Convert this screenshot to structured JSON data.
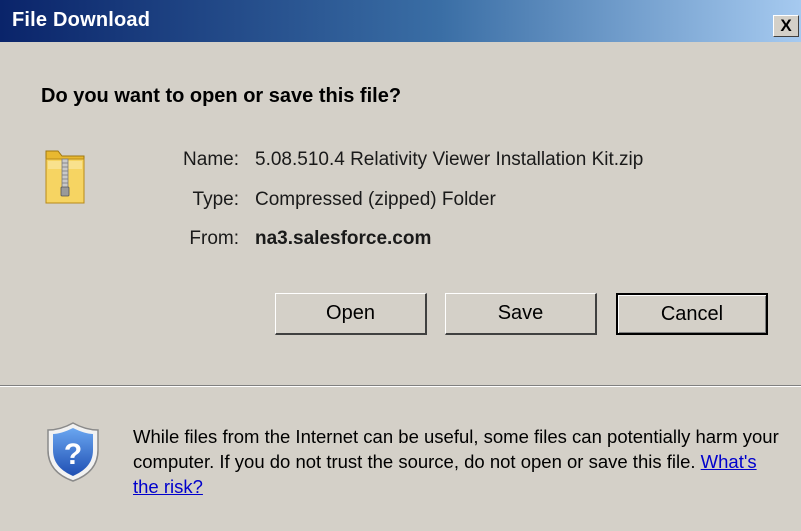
{
  "window": {
    "title": "File Download",
    "close_label": "X"
  },
  "prompt": {
    "question": "Do you want to open or save this file?"
  },
  "file": {
    "icon": "zip-folder-icon",
    "name_label": "Name:",
    "name_value": "5.08.510.4 Relativity Viewer Installation Kit.zip",
    "type_label": "Type:",
    "type_value": "Compressed (zipped) Folder",
    "from_label": "From:",
    "from_value": "na3.salesforce.com"
  },
  "buttons": {
    "open": "Open",
    "save": "Save",
    "cancel": "Cancel"
  },
  "warning": {
    "icon": "security-shield-question-icon",
    "text": "While files from the Internet can be useful, some files can potentially harm your computer. If you do not trust the source, do not open or save this file.",
    "link": "What's the risk?"
  },
  "colors": {
    "dialog_bg": "#d4d0c8",
    "title_gradient_start": "#0a246a",
    "title_gradient_end": "#a6caf0",
    "link": "#0000cc"
  }
}
